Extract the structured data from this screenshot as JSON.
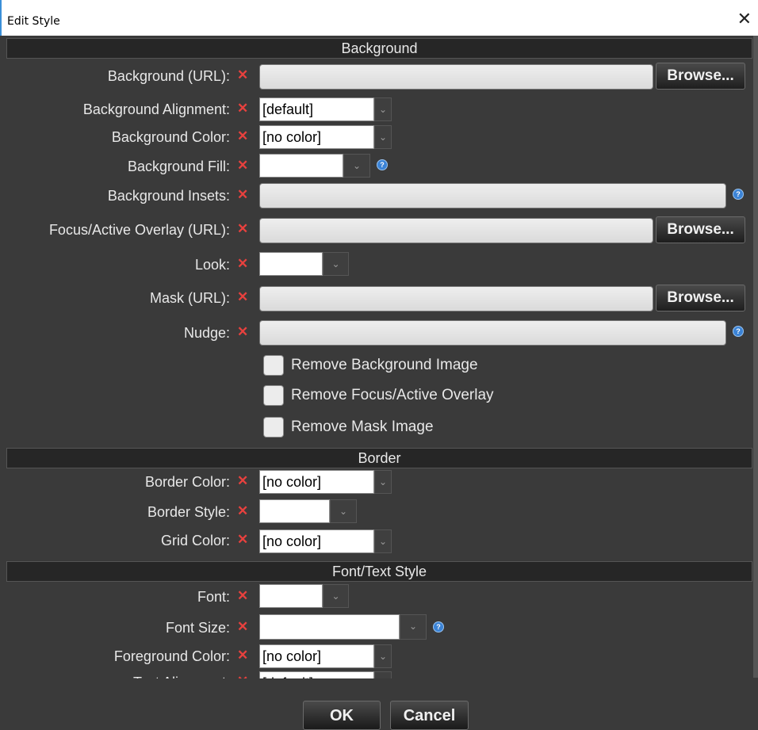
{
  "window": {
    "title": "Edit Style",
    "close_glyph": "✕"
  },
  "sections": {
    "background": "Background",
    "border": "Border",
    "font": "Font/Text Style"
  },
  "clear_glyph": "✕",
  "help_glyph": "?",
  "arrow_glyph": "⌄",
  "browse_label": "Browse...",
  "fields": {
    "bg_url": "Background (URL):",
    "bg_alignment": {
      "label": "Background Alignment:",
      "value": "[default]"
    },
    "bg_color": {
      "label": "Background Color:",
      "value": "[no color]"
    },
    "bg_fill": {
      "label": "Background Fill:",
      "value": ""
    },
    "bg_insets": "Background Insets:",
    "overlay_url": "Focus/Active Overlay (URL):",
    "look": {
      "label": "Look:",
      "value": ""
    },
    "mask_url": "Mask (URL):",
    "nudge": "Nudge:",
    "border_color": {
      "label": "Border Color:",
      "value": "[no color]"
    },
    "border_style": {
      "label": "Border Style:",
      "value": ""
    },
    "grid_color": {
      "label": "Grid Color:",
      "value": "[no color]"
    },
    "font": {
      "label": "Font:",
      "value": ""
    },
    "font_size": {
      "label": "Font Size:",
      "value": ""
    },
    "fg_color": {
      "label": "Foreground Color:",
      "value": "[no color]"
    },
    "text_alignment": {
      "label": "Text Alignment:",
      "value": "[default]"
    }
  },
  "checkboxes": {
    "remove_bg": "Remove Background Image",
    "remove_overlay": "Remove Focus/Active Overlay",
    "remove_mask": "Remove Mask Image"
  },
  "buttons": {
    "ok": "OK",
    "cancel": "Cancel"
  },
  "colors": {
    "dialog_bg": "#3a3a3a",
    "section_bg": "#262626",
    "clear_x": "#e8413e",
    "help_icon": "#3b83d6"
  }
}
